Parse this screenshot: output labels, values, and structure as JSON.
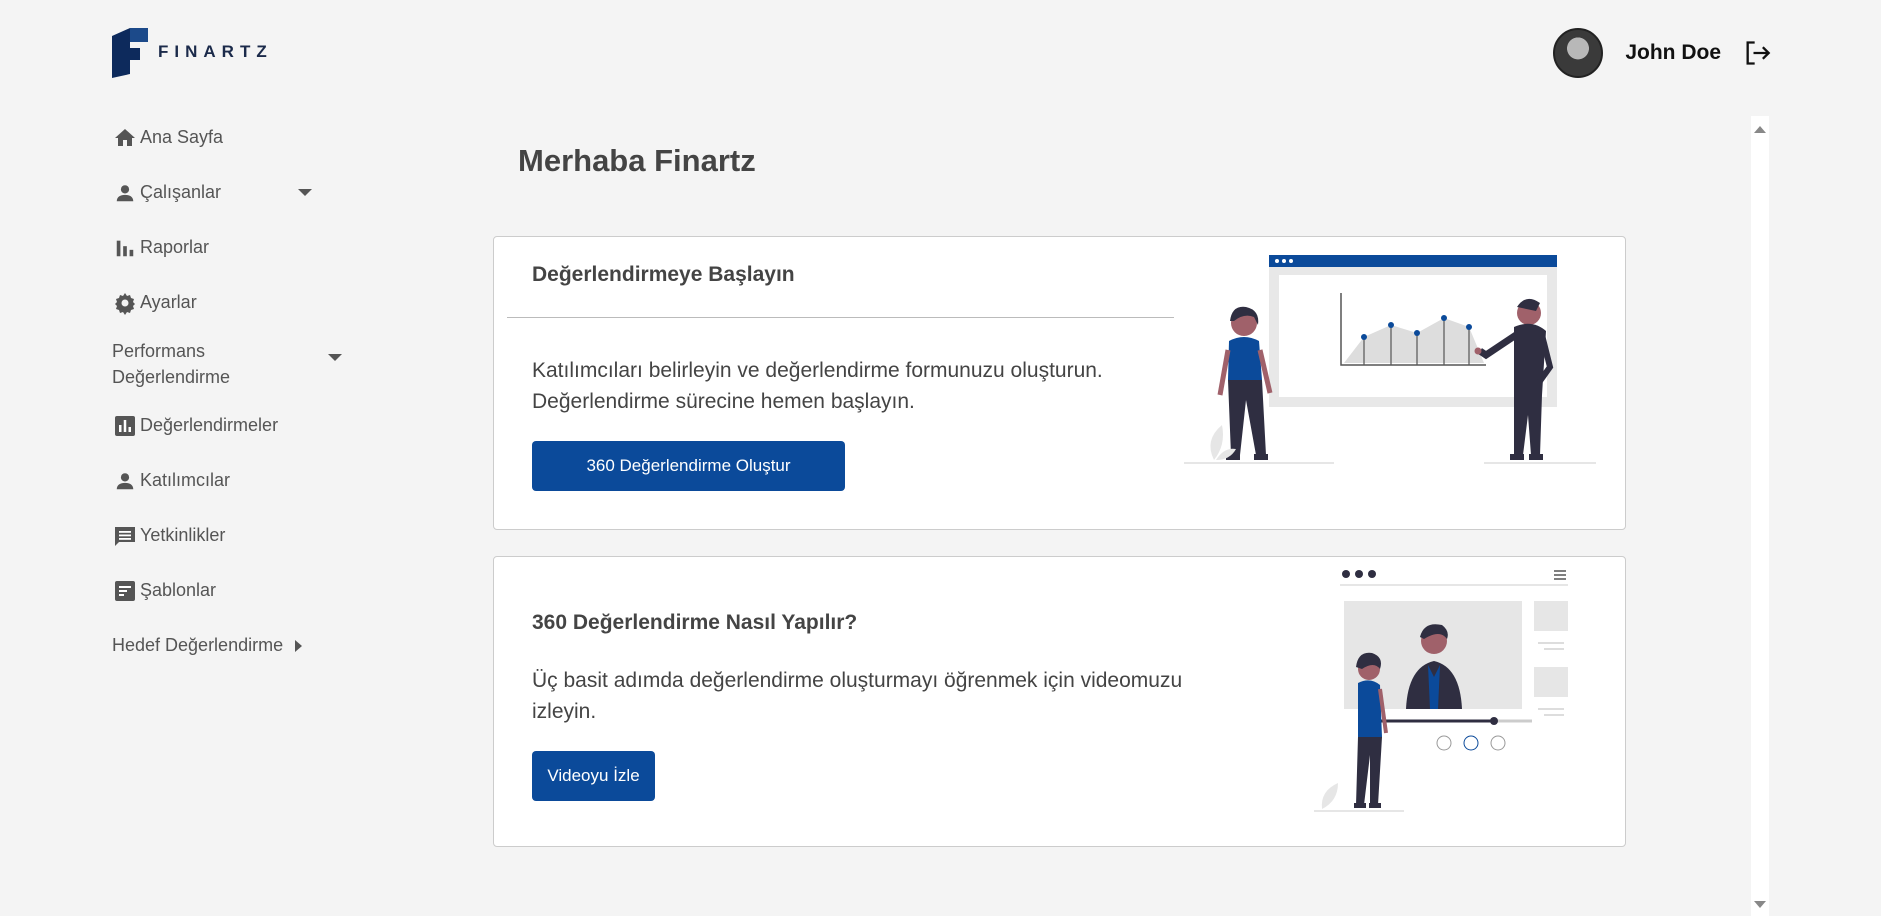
{
  "header": {
    "logo_text": "FINARTZ",
    "user_name": "John Doe"
  },
  "sidebar": {
    "items": [
      {
        "label": "Ana Sayfa",
        "icon": "home-icon"
      },
      {
        "label": "Çalışanlar",
        "icon": "person-icon"
      },
      {
        "label": "Raporlar",
        "icon": "bar-chart-icon"
      },
      {
        "label": "Ayarlar",
        "icon": "gear-icon"
      },
      {
        "label": "Performans Değerlendirme"
      },
      {
        "label": "Değerlendirmeler",
        "icon": "analytics-icon"
      },
      {
        "label": "Katılımcılar",
        "icon": "person-icon"
      },
      {
        "label": "Yetkinlikler",
        "icon": "comment-icon"
      },
      {
        "label": "Şablonlar",
        "icon": "template-icon"
      },
      {
        "label": "Hedef Değerlendirme"
      }
    ]
  },
  "main": {
    "greeting": "Merhaba Finartz",
    "card1": {
      "title": "Değerlendirmeye Başlayın",
      "line1": "Katılımcıları belirleyin ve değerlendirme formunuzu oluşturun.",
      "line2": "Değerlendirme sürecine hemen başlayın.",
      "button": "360 Değerlendirme Oluştur"
    },
    "card2": {
      "title": "360 Değerlendirme Nasıl Yapılır?",
      "line1": "Üç basit adımda değerlendirme oluşturmayı öğrenmek için videomuzu",
      "line2": "izleyin.",
      "button": "Videoyu İzle"
    }
  },
  "colors": {
    "accent": "#0b4a9a",
    "background": "#f4f4f4",
    "figure_dark": "#2f2e41",
    "skin": "#a0616a"
  }
}
